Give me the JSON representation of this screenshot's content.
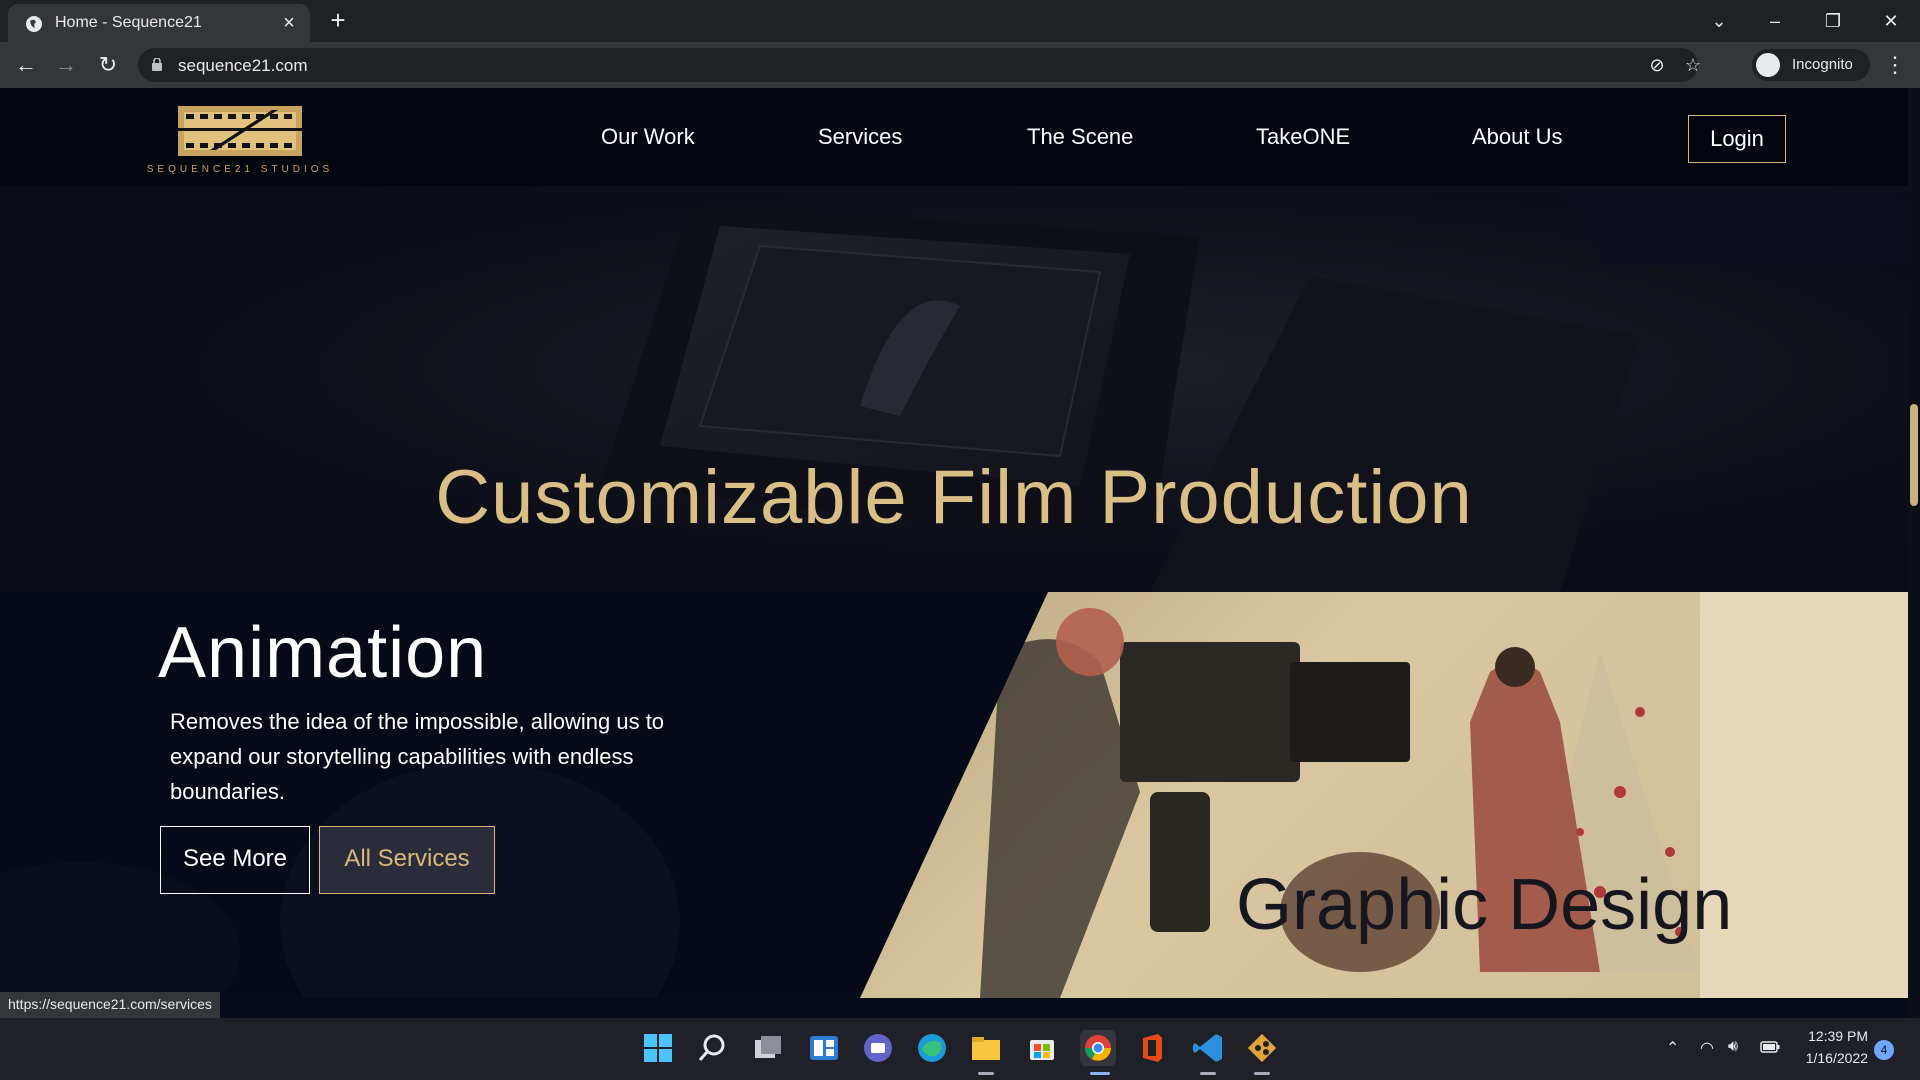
{
  "browser": {
    "tab_title": "Home - Sequence21",
    "url": "sequence21.com",
    "profile_label": "Incognito",
    "status_url": "https://sequence21.com/services"
  },
  "site": {
    "logo_text": "SEQUENCE21 STUDIOS",
    "nav": [
      "Our Work",
      "Services",
      "The Scene",
      "TakeONE",
      "About Us"
    ],
    "login_label": "Login",
    "hero_title": "Customizable Film Production",
    "left_service": {
      "heading": "Animation",
      "description": "Removes the idea of the impossible, allowing us to expand our storytelling capabilities with endless boundaries.",
      "see_more": "See More",
      "all_services": "All Services"
    },
    "right_service": {
      "heading": "Graphic Design"
    }
  },
  "taskbar": {
    "time": "12:39 PM",
    "date": "1/16/2022",
    "notification_count": "4"
  },
  "colors": {
    "accent_gold": "#d8b877",
    "page_bg": "#070a18"
  }
}
